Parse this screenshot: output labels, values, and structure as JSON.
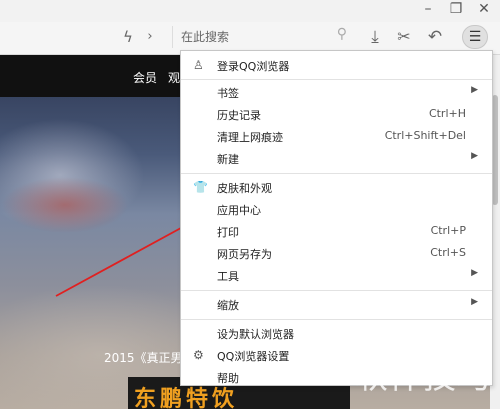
{
  "window": {
    "minimize_icon": "minimize-icon",
    "restore_icon": "restore-icon",
    "close_icon": "close-icon"
  },
  "toolbar": {
    "search_placeholder": "在此搜索"
  },
  "page": {
    "nav": [
      "会员",
      "观"
    ],
    "caption": "2015《真正男",
    "banner": "东鹏特饮"
  },
  "menu": {
    "login": "登录QQ浏览器",
    "bookmarks": "书签",
    "history": "历史记录",
    "history_shortcut": "Ctrl+H",
    "clear": "清理上网痕迹",
    "clear_shortcut": "Ctrl+Shift+Del",
    "new": "新建",
    "skin": "皮肤和外观",
    "apps": "应用中心",
    "print": "打印",
    "print_shortcut": "Ctrl+P",
    "save_as": "网页另存为",
    "save_shortcut": "Ctrl+S",
    "tools": "工具",
    "zoom": "缩放",
    "default_browser": "设为默认浏览器",
    "settings": "QQ浏览器设置",
    "help": "帮助"
  },
  "watermark": "软件技巧",
  "annotation_color": "#e02020"
}
